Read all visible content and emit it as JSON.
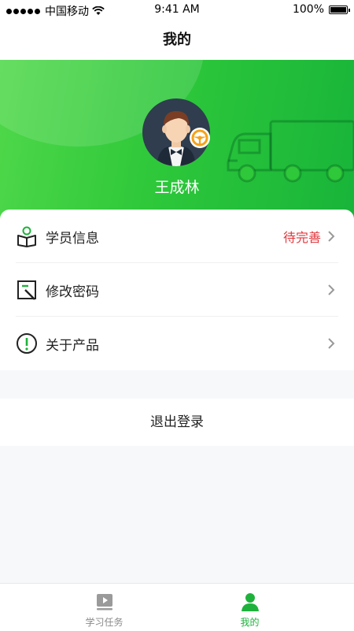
{
  "status_bar": {
    "carrier": "中国移动",
    "time": "9:41 AM",
    "battery": "100%"
  },
  "nav": {
    "title": "我的"
  },
  "profile": {
    "name": "王成林"
  },
  "menu": [
    {
      "label": "学员信息",
      "status": "待完善",
      "icon": "student-book-icon"
    },
    {
      "label": "修改密码",
      "icon": "edit-icon"
    },
    {
      "label": "关于产品",
      "icon": "info-icon"
    }
  ],
  "logout_label": "退出登录",
  "tabs": [
    {
      "label": "学习任务",
      "icon": "video-play-icon",
      "active": false
    },
    {
      "label": "我的",
      "icon": "user-icon",
      "active": true
    }
  ],
  "colors": {
    "accent": "#1eb23c",
    "warning": "#e0373d",
    "hero_start": "#4fd84a",
    "hero_end": "#18b43a"
  }
}
